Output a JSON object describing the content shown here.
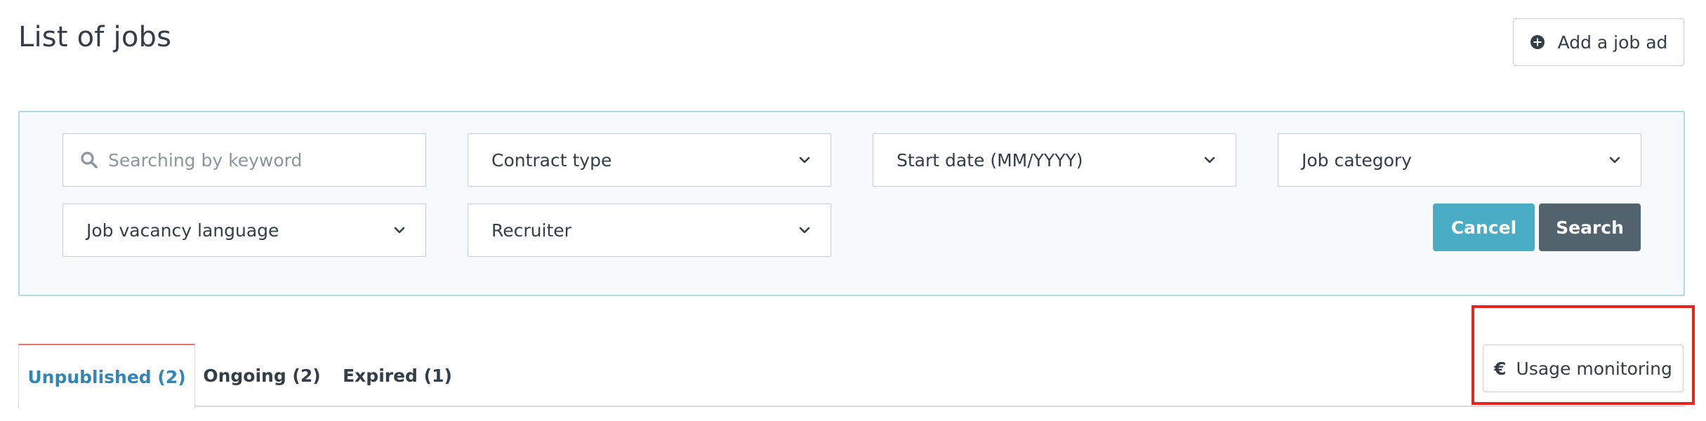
{
  "header": {
    "title": "List of jobs",
    "add_job_label": "Add a job ad"
  },
  "filters": {
    "search_placeholder": "Searching by keyword",
    "contract_type": "Contract type",
    "start_date": "Start date (MM/YYYY)",
    "job_category": "Job category",
    "job_vacancy_language": "Job vacancy language",
    "recruiter": "Recruiter",
    "cancel_label": "Cancel",
    "search_label": "Search"
  },
  "tabs": [
    {
      "label": "Unpublished (2)",
      "active": true
    },
    {
      "label": "Ongoing (2)",
      "active": false
    },
    {
      "label": "Expired (1)",
      "active": false
    }
  ],
  "usage_monitoring": {
    "currency_symbol": "€",
    "label": "Usage monitoring"
  },
  "colors": {
    "accent_blue": "#2f86b7",
    "cancel_button": "#4bacc6",
    "search_button": "#52636e",
    "active_tab_top": "#e8746b",
    "highlight_box": "#e8251a",
    "panel_bg": "#f6fafc",
    "panel_border": "#b5dae6"
  },
  "icons": {
    "add_job": "plus-circle-icon",
    "search": "search-icon",
    "dropdown": "chevron-down-icon"
  }
}
